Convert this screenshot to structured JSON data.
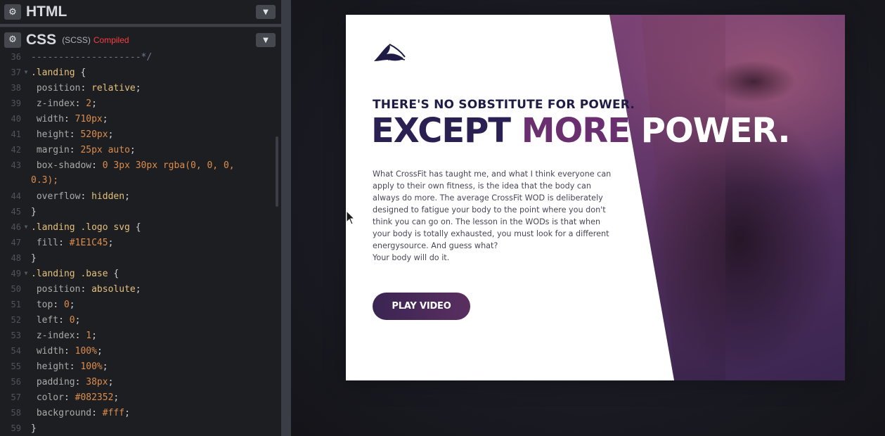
{
  "editors": {
    "html": {
      "title": "HTML"
    },
    "css": {
      "title": "CSS",
      "syntax": "(SCSS)",
      "status": "Compiled"
    }
  },
  "code_lines": [
    {
      "n": "36",
      "fold": false,
      "text": "--------------------*/",
      "kind": "comment"
    },
    {
      "n": "37",
      "fold": true,
      "text": ".landing {",
      "kind": "sel"
    },
    {
      "n": "38",
      "fold": false,
      "prop": "position",
      "val": "relative",
      "kind": "decl"
    },
    {
      "n": "39",
      "fold": false,
      "prop": "z-index",
      "val": "2",
      "kind": "decl"
    },
    {
      "n": "40",
      "fold": false,
      "prop": "width",
      "val": "710px",
      "kind": "decl"
    },
    {
      "n": "41",
      "fold": false,
      "prop": "height",
      "val": "520px",
      "kind": "decl"
    },
    {
      "n": "42",
      "fold": false,
      "prop": "margin",
      "val": "25px auto",
      "kind": "decl"
    },
    {
      "n": "43",
      "fold": false,
      "prop": "box-shadow",
      "val": "0 3px 30px rgba(0, 0, 0,",
      "kind": "decl"
    },
    {
      "n": "",
      "fold": false,
      "text": "0.3);",
      "kind": "cont"
    },
    {
      "n": "44",
      "fold": false,
      "prop": "overflow",
      "val": "hidden",
      "kind": "decl"
    },
    {
      "n": "45",
      "fold": false,
      "text": "}",
      "kind": "close"
    },
    {
      "n": "46",
      "fold": true,
      "text": ".landing .logo svg {",
      "kind": "sel"
    },
    {
      "n": "47",
      "fold": false,
      "prop": "fill",
      "val": "#1E1C45",
      "kind": "decl"
    },
    {
      "n": "48",
      "fold": false,
      "text": "}",
      "kind": "close"
    },
    {
      "n": "49",
      "fold": true,
      "text": ".landing .base {",
      "kind": "sel"
    },
    {
      "n": "50",
      "fold": false,
      "prop": "position",
      "val": "absolute",
      "kind": "decl"
    },
    {
      "n": "51",
      "fold": false,
      "prop": "top",
      "val": "0",
      "kind": "decl"
    },
    {
      "n": "52",
      "fold": false,
      "prop": "left",
      "val": "0",
      "kind": "decl"
    },
    {
      "n": "53",
      "fold": false,
      "prop": "z-index",
      "val": "1",
      "kind": "decl"
    },
    {
      "n": "54",
      "fold": false,
      "prop": "width",
      "val": "100%",
      "kind": "decl"
    },
    {
      "n": "55",
      "fold": false,
      "prop": "height",
      "val": "100%",
      "kind": "decl"
    },
    {
      "n": "56",
      "fold": false,
      "prop": "padding",
      "val": "38px",
      "kind": "decl"
    },
    {
      "n": "57",
      "fold": false,
      "prop": "color",
      "val": "#082352",
      "kind": "decl"
    },
    {
      "n": "58",
      "fold": false,
      "prop": "background",
      "val": "#fff",
      "kind": "decl"
    },
    {
      "n": "59",
      "fold": false,
      "text": "}",
      "kind": "close"
    }
  ],
  "landing": {
    "tagline": "THERE'S NO SOBSTITUTE FOR POWER.",
    "headline_part1": "EXCEPT ",
    "headline_part2": "MORE ",
    "headline_part3": "POWER.",
    "body": "What CrossFit has taught me, and what I think everyone can apply to their own fitness, is the idea that the body can always do more. The average CrossFit WOD is deliberately designed to fatigue your body to the point where you don't think you can go on. The lesson in the WODs is that when your body is totally exhausted, you must look for a different energysource. And guess what?",
    "body_last": "Your body will do it.",
    "play_button": "PLAY VIDEO"
  },
  "colors": {
    "logo": "#1E1C45",
    "compiled": "#ff3c41",
    "button_start": "#3a2553",
    "button_end": "#5a2f60"
  }
}
